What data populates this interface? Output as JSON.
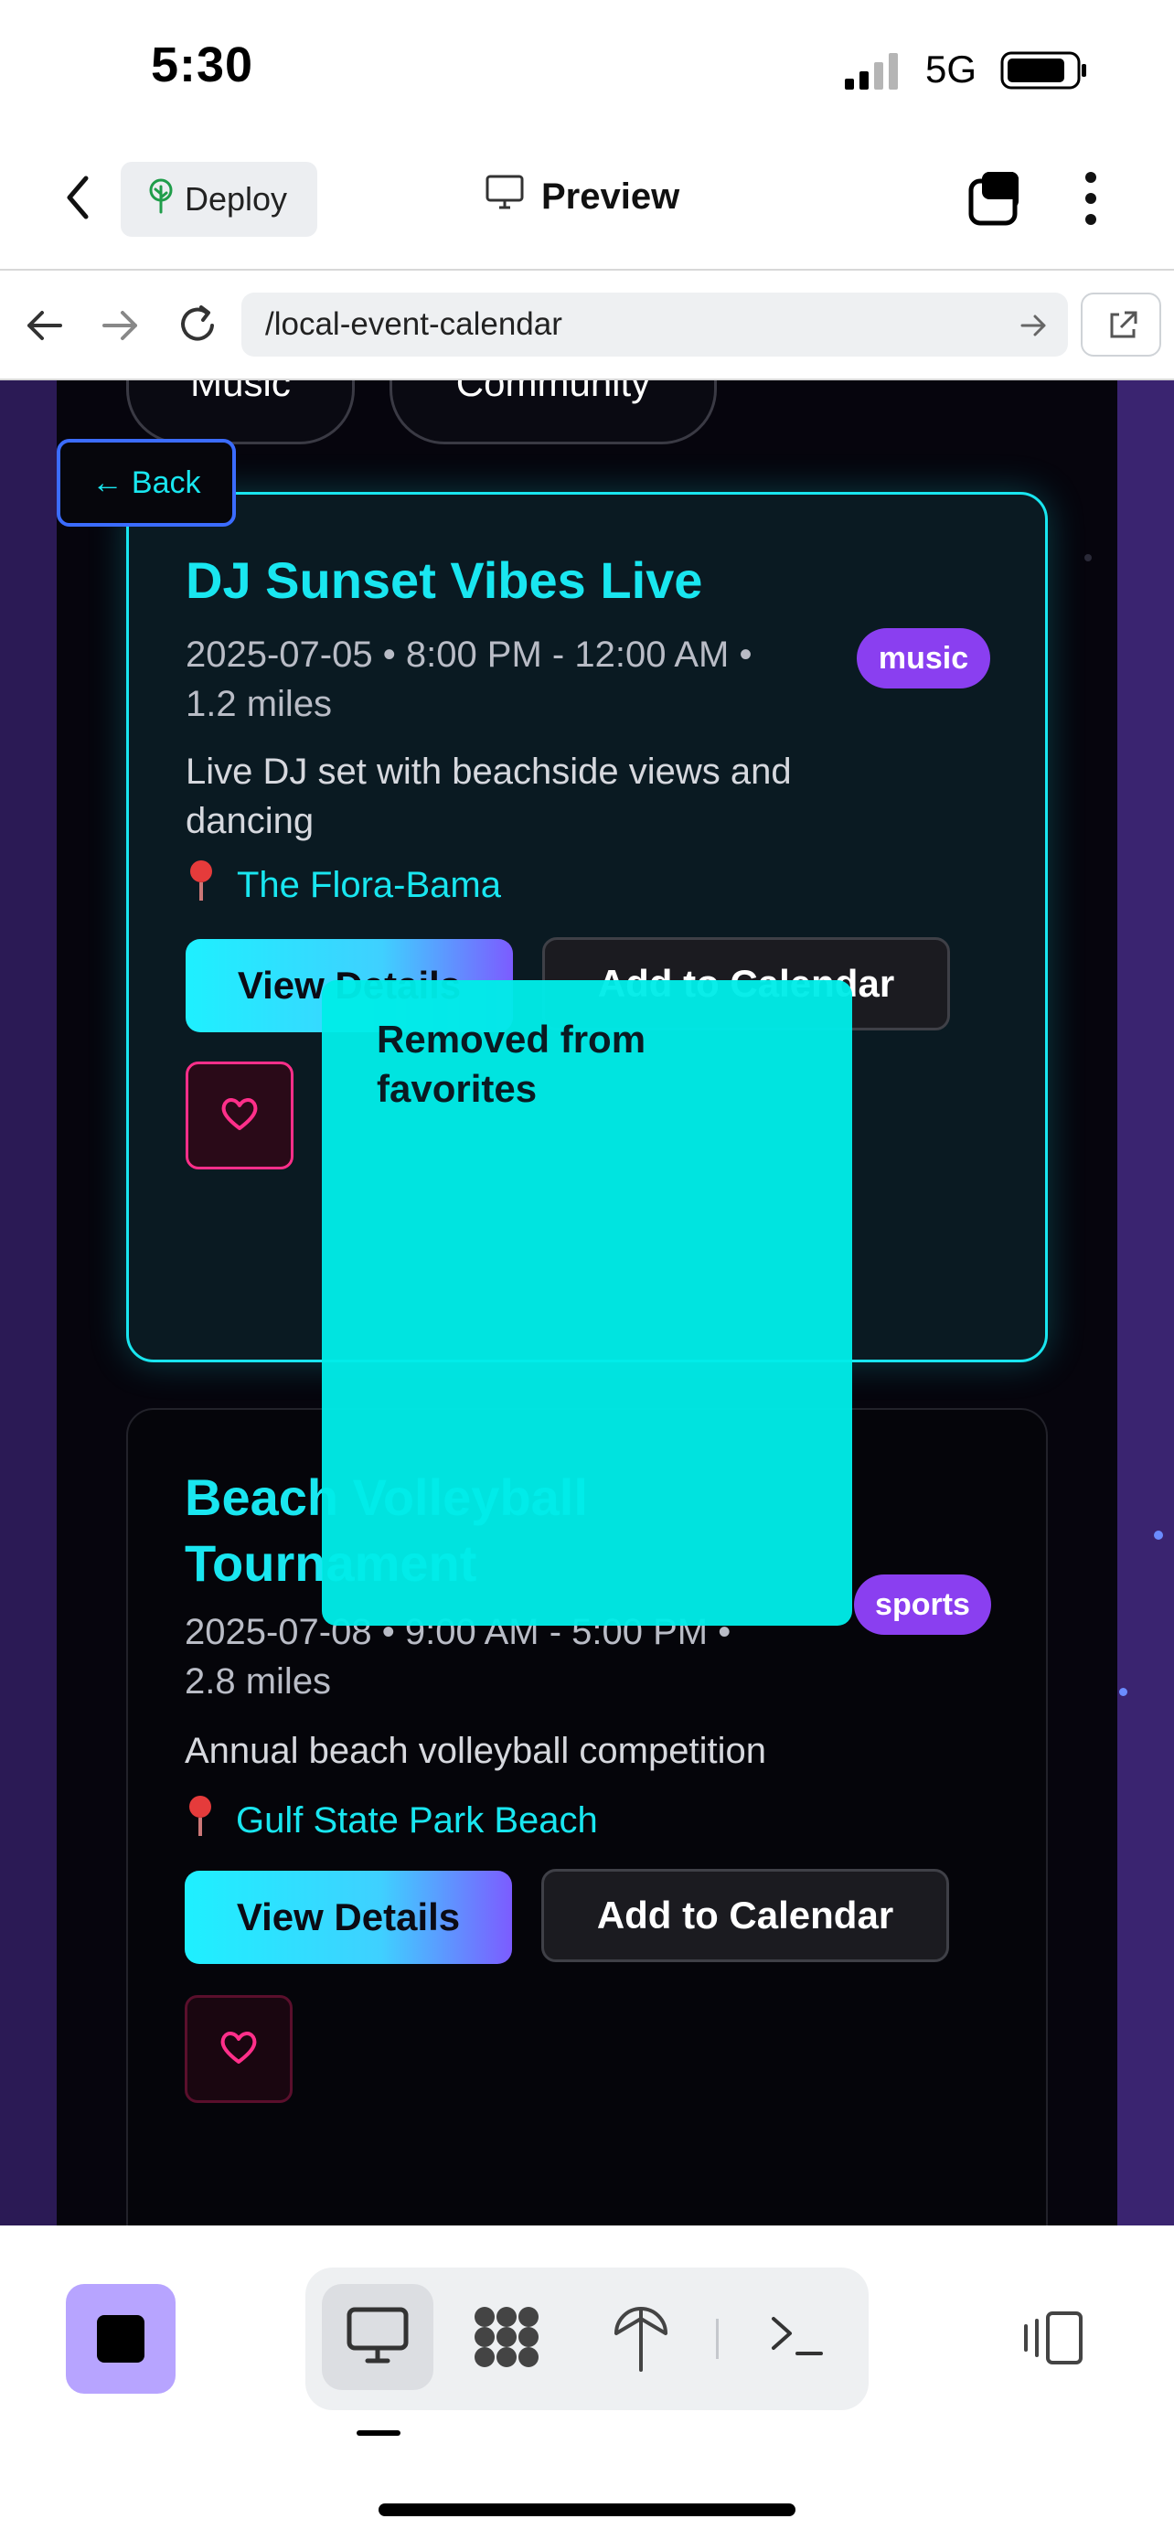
{
  "status_bar": {
    "time": "5:30",
    "network": "5G"
  },
  "app_header": {
    "deploy_label": "Deploy",
    "preview_label": "Preview"
  },
  "browser": {
    "url": "/local-event-calendar"
  },
  "filters": [
    "Music",
    "Community"
  ],
  "back_label": "← Back",
  "events": [
    {
      "title_lines": [
        "DJ Sunset Vibes Live"
      ],
      "meta_lines": [
        "2025-07-05 • 8:00 PM - 12:00 AM •",
        "1.2 miles"
      ],
      "tag": "music",
      "description_lines": [
        "Live DJ set with beachside views and",
        "dancing"
      ],
      "location": "The Flora-Bama",
      "view_label": "View Details",
      "calendar_label": "Add to Calendar"
    },
    {
      "title_lines": [
        "Beach Volleyball",
        "Tournament"
      ],
      "meta_lines": [
        "2025-07-08 • 9:00 AM - 5:00 PM •",
        "2.8 miles"
      ],
      "tag": "sports",
      "description_lines": [
        "Annual beach volleyball competition"
      ],
      "location": "Gulf State Park Beach",
      "view_label": "View Details",
      "calendar_label": "Add to Calendar"
    }
  ],
  "toast": {
    "message": "Removed from favorites"
  },
  "colors": {
    "accent_cyan": "#19e6f0",
    "tag_purple": "#8a3ff0",
    "favorite_pink": "#ff2f8a",
    "toast_bg": "#00ece8"
  }
}
